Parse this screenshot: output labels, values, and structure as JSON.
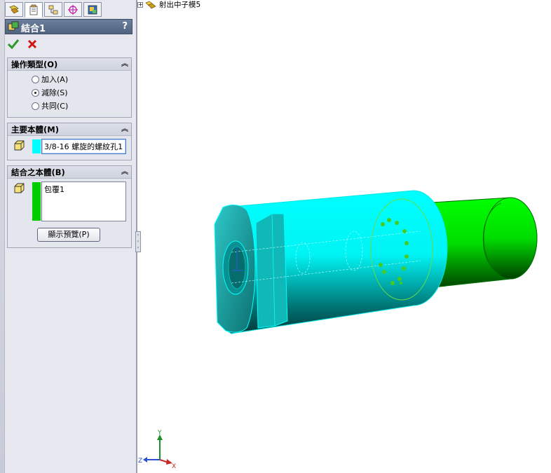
{
  "tabs": [
    {
      "icon": "feature-manager-icon"
    },
    {
      "icon": "property-manager-icon",
      "active": true
    },
    {
      "icon": "configuration-manager-icon"
    },
    {
      "icon": "dimxpert-icon"
    },
    {
      "icon": "display-manager-icon"
    }
  ],
  "title": {
    "text": "結合1",
    "help": "?"
  },
  "actions": {
    "ok_icon": "checkmark-icon",
    "cancel_icon": "cancel-x-icon"
  },
  "operation": {
    "header": "操作類型(O)",
    "options": [
      {
        "label": "加入(A)",
        "selected": false
      },
      {
        "label": "減除(S)",
        "selected": true
      },
      {
        "label": "共同(C)",
        "selected": false
      }
    ]
  },
  "main_body": {
    "header": "主要本體(M)",
    "value": "3/8-16 螺旋的螺紋孔1",
    "swatch_color": "#00ffff"
  },
  "combine_bodies": {
    "header": "結合之本體(B)",
    "items": [
      "包覆1"
    ],
    "swatch_color": "#00cc00",
    "preview_button": "顯示預覽(P)"
  },
  "tree": {
    "node_label": "射出中子模5",
    "expander": "+"
  },
  "triad": {
    "x": "X",
    "y": "Y",
    "z": "Z"
  },
  "colors": {
    "cyan_body": "#00ffff",
    "green_body": "#00c800",
    "panel_bg": "#e7e8ef"
  }
}
